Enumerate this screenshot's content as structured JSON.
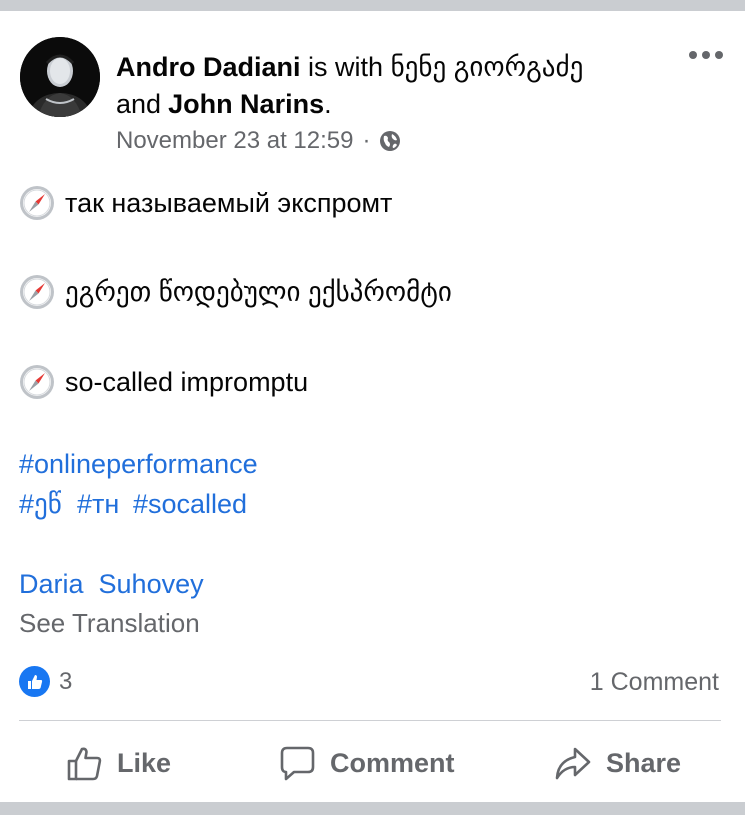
{
  "post": {
    "author": "Andro Dadiani",
    "with_text": "is with",
    "tagged_person_1": "ნენე გიორგაძე",
    "and_text": "and",
    "tagged_person_2": "John Narins",
    "period": ".",
    "timestamp": "November 23 at 12:59",
    "separator": "·",
    "privacy_icon": "globe-icon",
    "more_icon": "more-options-icon",
    "body_lines": [
      {
        "icon": "compass-emoji-icon",
        "text": "так называемый экспромт"
      },
      {
        "icon": "compass-emoji-icon",
        "text": "ეგრეთ წოდებული ექსპრომტი"
      },
      {
        "icon": "compass-emoji-icon",
        "text": "so-called impromptu"
      }
    ],
    "hashtags": [
      "#onlineperformance",
      "#ეწ",
      "#тн",
      "#socalled"
    ],
    "mention": "Daria  Suhovey",
    "see_translation": "See Translation"
  },
  "stats": {
    "reaction_icon": "like-reaction-icon",
    "reaction_count": "3",
    "comments": "1 Comment"
  },
  "actions": {
    "like": "Like",
    "comment": "Comment",
    "share": "Share"
  },
  "colors": {
    "link": "#216fdb",
    "secondary_text": "#65676b",
    "primary_text": "#050505",
    "like_blue": "#1877f2",
    "band": "#cacdd1"
  }
}
